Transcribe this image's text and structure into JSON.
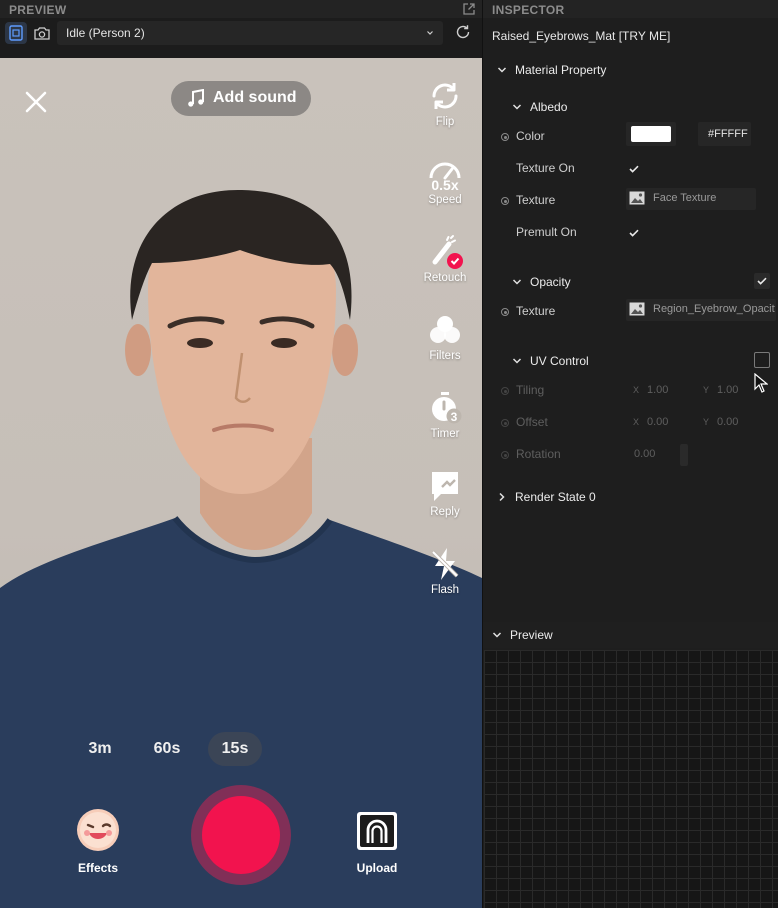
{
  "preview": {
    "title": "PREVIEW",
    "mode_value": "Idle (Person 2)",
    "add_sound_label": "Add sound",
    "side_tools": [
      {
        "label": "Flip"
      },
      {
        "label": "Speed",
        "badge": "0.5x"
      },
      {
        "label": "Retouch"
      },
      {
        "label": "Filters"
      },
      {
        "label": "Timer",
        "badge": "3"
      },
      {
        "label": "Reply"
      },
      {
        "label": "Flash"
      }
    ],
    "durations": [
      "3m",
      "60s",
      "15s"
    ],
    "selected_duration": "15s",
    "effects_label": "Effects",
    "upload_label": "Upload"
  },
  "inspector": {
    "title": "INSPECTOR",
    "material_name": "Raised_Eyebrows_Mat [TRY ME]",
    "material_property_label": "Material Property",
    "albedo": {
      "label": "Albedo",
      "color_label": "Color",
      "color_value": "#FFFFF",
      "color_swatch": "#ffffff",
      "texture_on_label": "Texture On",
      "texture_on": true,
      "texture_label": "Texture",
      "texture_value": "Face Texture",
      "premult_on_label": "Premult On",
      "premult_on": true
    },
    "opacity": {
      "label": "Opacity",
      "enabled": true,
      "texture_label": "Texture",
      "texture_value": "Region_Eyebrow_Opacity"
    },
    "uv_control": {
      "label": "UV Control",
      "enabled": false,
      "tiling_label": "Tiling",
      "tiling_x": "1.00",
      "tiling_y": "1.00",
      "offset_label": "Offset",
      "offset_x": "0.00",
      "offset_y": "0.00",
      "rotation_label": "Rotation",
      "rotation": "0.00",
      "x_axis": "X",
      "y_axis": "Y"
    },
    "render_state_label": "Render State 0",
    "preview_label": "Preview"
  },
  "colors": {
    "accent_record": "#f2134e",
    "panel_bg": "#1e1e1e"
  }
}
